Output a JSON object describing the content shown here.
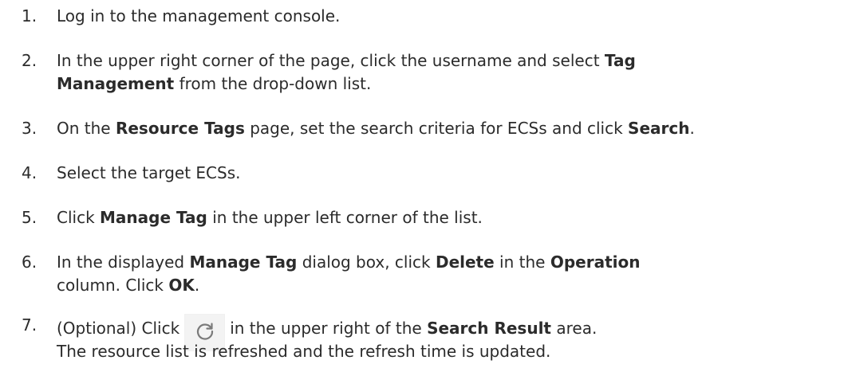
{
  "steps": [
    {
      "num": "1.",
      "parts": [
        {
          "t": "Log in to the management console."
        }
      ]
    },
    {
      "num": "2.",
      "line1": [
        {
          "t": "In the upper right corner of the page, click the username and select "
        },
        {
          "t": "Tag",
          "b": true
        }
      ],
      "line2": [
        {
          "t": "Management",
          "b": true
        },
        {
          "t": " from the drop-down list."
        }
      ]
    },
    {
      "num": "3.",
      "parts": [
        {
          "t": "On the "
        },
        {
          "t": "Resource Tags",
          "b": true
        },
        {
          "t": " page, set the search criteria for ECSs and click "
        },
        {
          "t": "Search",
          "b": true
        },
        {
          "t": "."
        }
      ]
    },
    {
      "num": "4.",
      "parts": [
        {
          "t": "Select the target ECSs."
        }
      ]
    },
    {
      "num": "5.",
      "parts": [
        {
          "t": "Click "
        },
        {
          "t": "Manage Tag",
          "b": true
        },
        {
          "t": " in the upper left corner of the list."
        }
      ]
    },
    {
      "num": "6.",
      "line1": [
        {
          "t": "In the displayed "
        },
        {
          "t": "Manage Tag",
          "b": true
        },
        {
          "t": " dialog box, click "
        },
        {
          "t": "Delete",
          "b": true
        },
        {
          "t": " in the "
        },
        {
          "t": "Operation",
          "b": true
        }
      ],
      "line2": [
        {
          "t": "column. Click "
        },
        {
          "t": "OK",
          "b": true
        },
        {
          "t": "."
        }
      ]
    },
    {
      "num": "7.",
      "before_icon": "(Optional) Click",
      "after_icon_parts": [
        {
          "t": "in the upper right of the "
        },
        {
          "t": "Search Result",
          "b": true
        },
        {
          "t": " area."
        }
      ],
      "icon": "refresh-icon"
    }
  ],
  "note": "The resource list is refreshed and the refresh time is updated."
}
